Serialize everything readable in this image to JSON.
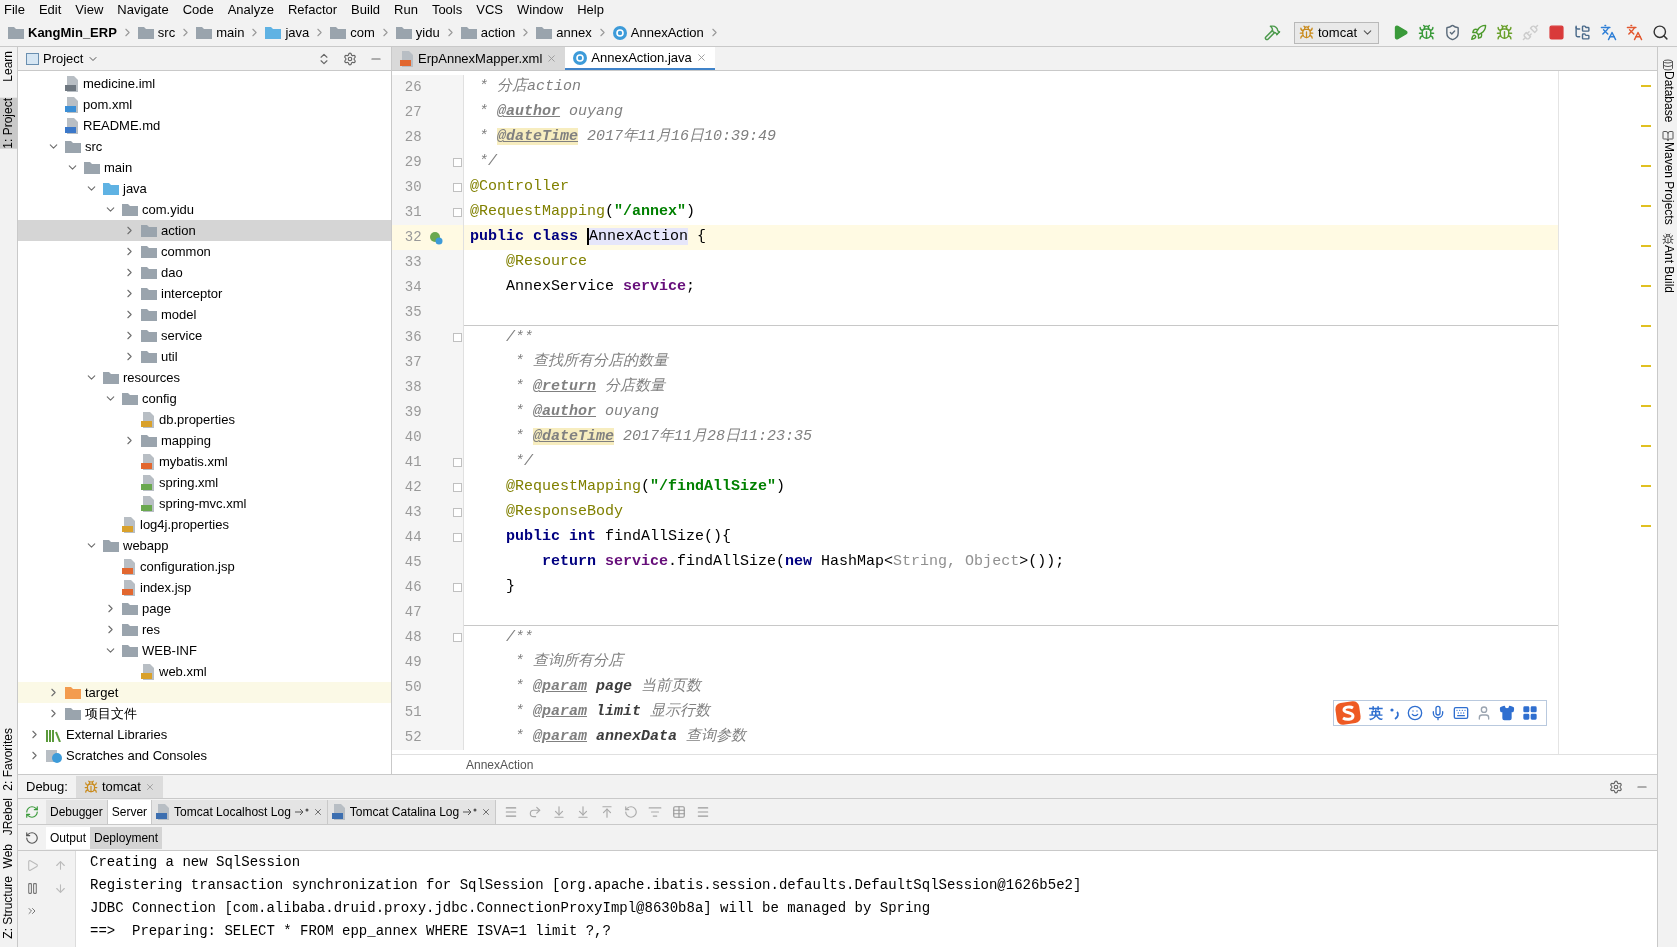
{
  "menu": [
    "File",
    "Edit",
    "View",
    "Navigate",
    "Code",
    "Analyze",
    "Refactor",
    "Build",
    "Run",
    "Tools",
    "VCS",
    "Window",
    "Help"
  ],
  "breadcrumb": [
    {
      "label": "KangMin_ERP",
      "kind": "project"
    },
    {
      "label": "src",
      "kind": "folder"
    },
    {
      "label": "main",
      "kind": "folder"
    },
    {
      "label": "java",
      "kind": "source-folder"
    },
    {
      "label": "com",
      "kind": "package"
    },
    {
      "label": "yidu",
      "kind": "package"
    },
    {
      "label": "action",
      "kind": "package"
    },
    {
      "label": "annex",
      "kind": "package"
    },
    {
      "label": "AnnexAction",
      "kind": "class"
    }
  ],
  "toolbar": [
    {
      "kind": "build",
      "disabled": false
    },
    {
      "kind": "run-config",
      "label": "tomcat",
      "disabled": false
    },
    {
      "kind": "run",
      "disabled": false
    },
    {
      "kind": "debug",
      "disabled": false
    },
    {
      "kind": "coverage",
      "disabled": false
    },
    {
      "kind": "jrebel-run",
      "disabled": false
    },
    {
      "kind": "jrebel-debug",
      "disabled": false
    },
    {
      "kind": "attach",
      "disabled": true
    },
    {
      "kind": "stop",
      "disabled": false
    },
    {
      "kind": "structure",
      "disabled": false
    },
    {
      "kind": "translate",
      "disabled": false
    },
    {
      "kind": "translate-alt",
      "disabled": false
    },
    {
      "kind": "search",
      "disabled": false
    }
  ],
  "left_stripe": {
    "top": [
      {
        "label": "Learn",
        "selected": false
      },
      {
        "label": "1: Project",
        "selected": true
      }
    ],
    "bottom": [
      {
        "label": "2: Favorites",
        "selected": false
      },
      {
        "label": "JRebel",
        "selected": false
      },
      {
        "label": "Web",
        "selected": false
      },
      {
        "label": "Z: Structure",
        "selected": false
      }
    ]
  },
  "right_stripe": [
    {
      "label": "Database",
      "kind": "database"
    },
    {
      "label": "Maven Projects",
      "kind": "maven"
    },
    {
      "label": "Ant Build",
      "kind": "ant"
    }
  ],
  "project_panel": {
    "title": "Project",
    "project_items": [
      {
        "label": "medicine.iml",
        "kind": "module-file",
        "selected": false
      },
      {
        "label": "pom.xml",
        "kind": "maven-file",
        "selected": false
      },
      {
        "label": "README.md",
        "kind": "markdown-file",
        "selected": false
      },
      {
        "label": "src",
        "kind": "folder",
        "expanded": true,
        "selected": false,
        "children": [
          {
            "label": "main",
            "kind": "folder",
            "expanded": true,
            "selected": false,
            "children": [
              {
                "label": "java",
                "kind": "source-folder",
                "expanded": true,
                "selected": false,
                "children": [
                  {
                    "label": "com.yidu",
                    "kind": "package",
                    "expanded": true,
                    "selected": false,
                    "children": [
                      {
                        "label": "action",
                        "kind": "package",
                        "expanded": false,
                        "selected": true
                      },
                      {
                        "label": "common",
                        "kind": "package",
                        "expanded": false,
                        "selected": false
                      },
                      {
                        "label": "dao",
                        "kind": "package",
                        "expanded": false,
                        "selected": false
                      },
                      {
                        "label": "interceptor",
                        "kind": "package",
                        "expanded": false,
                        "selected": false
                      },
                      {
                        "label": "model",
                        "kind": "package",
                        "expanded": false,
                        "selected": false
                      },
                      {
                        "label": "service",
                        "kind": "package",
                        "expanded": false,
                        "selected": false
                      },
                      {
                        "label": "util",
                        "kind": "package",
                        "expanded": false,
                        "selected": false
                      }
                    ]
                  }
                ]
              },
              {
                "label": "resources",
                "kind": "resource-folder",
                "expanded": true,
                "selected": false,
                "children": [
                  {
                    "label": "config",
                    "kind": "package",
                    "expanded": true,
                    "selected": false,
                    "children": [
                      {
                        "label": "db.properties",
                        "kind": "properties-file",
                        "selected": false
                      },
                      {
                        "label": "mapping",
                        "kind": "package",
                        "expanded": false,
                        "selected": false
                      },
                      {
                        "label": "mybatis.xml",
                        "kind": "xml-file",
                        "selected": false
                      },
                      {
                        "label": "spring.xml",
                        "kind": "spring-file",
                        "selected": false
                      },
                      {
                        "label": "spring-mvc.xml",
                        "kind": "spring-file",
                        "selected": false
                      }
                    ]
                  },
                  {
                    "label": "log4j.properties",
                    "kind": "properties-file",
                    "selected": false
                  }
                ]
              },
              {
                "label": "webapp",
                "kind": "web-folder",
                "expanded": true,
                "selected": false,
                "children": [
                  {
                    "label": "configuration.jsp",
                    "kind": "jsp-file",
                    "selected": false
                  },
                  {
                    "label": "index.jsp",
                    "kind": "jsp-file",
                    "selected": false
                  },
                  {
                    "label": "page",
                    "kind": "folder",
                    "expanded": false,
                    "selected": false
                  },
                  {
                    "label": "res",
                    "kind": "folder",
                    "expanded": false,
                    "selected": false
                  },
                  {
                    "label": "WEB-INF",
                    "kind": "folder",
                    "expanded": true,
                    "selected": false,
                    "children": [
                      {
                        "label": "web.xml",
                        "kind": "web-xml-file",
                        "selected": false
                      }
                    ]
                  }
                ]
              }
            ]
          }
        ]
      },
      {
        "label": "target",
        "kind": "excluded-folder",
        "expanded": false,
        "selected": false
      },
      {
        "label": "项目文件",
        "kind": "folder",
        "expanded": false,
        "selected": false
      }
    ],
    "root_items": [
      {
        "label": "External Libraries",
        "kind": "library",
        "expanded": false,
        "selected": false
      },
      {
        "label": "Scratches and Consoles",
        "kind": "scratches",
        "expanded": false,
        "selected": false
      }
    ]
  },
  "editor": {
    "tabs": [
      {
        "label": "ErpAnnexMapper.xml",
        "kind": "xml",
        "selected": false
      },
      {
        "label": "AnnexAction.java",
        "kind": "class",
        "selected": true
      }
    ],
    "lines": [
      {
        "number": "26",
        "tokens": [
          {
            "text": " * 分店action",
            "kind": "doc"
          }
        ]
      },
      {
        "number": "27",
        "tokens": [
          {
            "text": " * ",
            "kind": "doc"
          },
          {
            "text": "@author",
            "kind": "tag"
          },
          {
            "text": " ouyang",
            "kind": "doc"
          }
        ]
      },
      {
        "number": "28",
        "tokens": [
          {
            "text": " * ",
            "kind": "doc"
          },
          {
            "text": "@dateTime",
            "kind": "tag-hl"
          },
          {
            "text": " 2017年11月16日10:39:49",
            "kind": "doc"
          }
        ]
      },
      {
        "number": "29",
        "fold": true,
        "tokens": [
          {
            "text": " */",
            "kind": "doc"
          }
        ]
      },
      {
        "number": "30",
        "fold": true,
        "tokens": [
          {
            "text": "@Controller",
            "kind": "annotation"
          }
        ]
      },
      {
        "number": "31",
        "fold": true,
        "tokens": [
          {
            "text": "@RequestMapping",
            "kind": "annotation"
          },
          {
            "text": "(",
            "kind": "plain"
          },
          {
            "text": "\"/annex\"",
            "kind": "string"
          },
          {
            "text": ")",
            "kind": "plain"
          }
        ]
      },
      {
        "number": "32",
        "current": true,
        "bean": true,
        "tokens": [
          {
            "text": "public class ",
            "kind": "keyword"
          },
          {
            "text": "AnnexAction",
            "kind": "caret-ident"
          },
          {
            "text": " {",
            "kind": "plain"
          }
        ]
      },
      {
        "number": "33",
        "tokens": [
          {
            "text": "    @Resource",
            "kind": "annotation"
          }
        ]
      },
      {
        "number": "34",
        "tokens": [
          {
            "text": "    AnnexService ",
            "kind": "plain"
          },
          {
            "text": "service",
            "kind": "field"
          },
          {
            "text": ";",
            "kind": "plain"
          }
        ]
      },
      {
        "number": "35"
      },
      {
        "number": "36",
        "fold": true,
        "separator": true,
        "tokens": [
          {
            "text": "    /**",
            "kind": "doc"
          }
        ]
      },
      {
        "number": "37",
        "tokens": [
          {
            "text": "     * 查找所有分店的数量",
            "kind": "doc"
          }
        ]
      },
      {
        "number": "38",
        "tokens": [
          {
            "text": "     * ",
            "kind": "doc"
          },
          {
            "text": "@return",
            "kind": "tag"
          },
          {
            "text": " 分店数量",
            "kind": "doc"
          }
        ]
      },
      {
        "number": "39",
        "tokens": [
          {
            "text": "     * ",
            "kind": "doc"
          },
          {
            "text": "@author",
            "kind": "tag"
          },
          {
            "text": " ouyang",
            "kind": "doc"
          }
        ]
      },
      {
        "number": "40",
        "tokens": [
          {
            "text": "     * ",
            "kind": "doc"
          },
          {
            "text": "@dateTime",
            "kind": "tag-hl"
          },
          {
            "text": " 2017年11月28日11:23:35",
            "kind": "doc"
          }
        ]
      },
      {
        "number": "41",
        "fold": true,
        "tokens": [
          {
            "text": "     */",
            "kind": "doc"
          }
        ]
      },
      {
        "number": "42",
        "fold": true,
        "tokens": [
          {
            "text": "    @RequestMapping",
            "kind": "annotation"
          },
          {
            "text": "(",
            "kind": "plain"
          },
          {
            "text": "\"/findAllSize\"",
            "kind": "string"
          },
          {
            "text": ")",
            "kind": "plain"
          }
        ]
      },
      {
        "number": "43",
        "fold": true,
        "tokens": [
          {
            "text": "    @ResponseBody",
            "kind": "annotation"
          }
        ]
      },
      {
        "number": "44",
        "fold": true,
        "tokens": [
          {
            "text": "    public int ",
            "kind": "keyword"
          },
          {
            "text": "findAllSize(){",
            "kind": "plain"
          }
        ]
      },
      {
        "number": "45",
        "tokens": [
          {
            "text": "        return ",
            "kind": "keyword"
          },
          {
            "text": "service",
            "kind": "field"
          },
          {
            "text": ".findAllSize(",
            "kind": "plain"
          },
          {
            "text": "new ",
            "kind": "keyword"
          },
          {
            "text": "HashMap<",
            "kind": "plain"
          },
          {
            "text": "String, Object",
            "kind": "generic"
          },
          {
            "text": ">());",
            "kind": "plain"
          }
        ]
      },
      {
        "number": "46",
        "fold": true,
        "tokens": [
          {
            "text": "    }",
            "kind": "plain"
          }
        ]
      },
      {
        "number": "47"
      },
      {
        "number": "48",
        "fold": true,
        "separator": true,
        "tokens": [
          {
            "text": "    /**",
            "kind": "doc"
          }
        ]
      },
      {
        "number": "49",
        "tokens": [
          {
            "text": "     * 查询所有分店",
            "kind": "doc"
          }
        ]
      },
      {
        "number": "50",
        "tokens": [
          {
            "text": "     * ",
            "kind": "doc"
          },
          {
            "text": "@param",
            "kind": "tag"
          },
          {
            "text": " page",
            "kind": "param"
          },
          {
            "text": " 当前页数",
            "kind": "doc"
          }
        ]
      },
      {
        "number": "51",
        "tokens": [
          {
            "text": "     * ",
            "kind": "doc"
          },
          {
            "text": "@param",
            "kind": "tag"
          },
          {
            "text": " limit",
            "kind": "param"
          },
          {
            "text": " 显示行数",
            "kind": "doc"
          }
        ]
      },
      {
        "number": "52",
        "tokens": [
          {
            "text": "     * ",
            "kind": "doc"
          },
          {
            "text": "@param",
            "kind": "tag"
          },
          {
            "text": " annexData",
            "kind": "param"
          },
          {
            "text": " 查询参数",
            "kind": "doc"
          }
        ]
      }
    ],
    "footer": "AnnexAction"
  },
  "ime_toolbar": {
    "mode": "英"
  },
  "debug": {
    "title": "Debug:",
    "session_tab": "tomcat",
    "tabs": [
      {
        "label": "Debugger",
        "selected": false,
        "pinned": false
      },
      {
        "label": "Server",
        "selected": true,
        "pinned": false
      },
      {
        "label": "Tomcat Localhost Log",
        "selected": false,
        "pinned": true
      },
      {
        "label": "Tomcat Catalina Log",
        "selected": false,
        "pinned": true
      }
    ],
    "sub_tabs": [
      {
        "label": "Output",
        "selected": true
      },
      {
        "label": "Deployment",
        "selected": false
      }
    ],
    "console": [
      "Creating a new SqlSession",
      "Registering transaction synchronization for SqlSession [org.apache.ibatis.session.defaults.DefaultSqlSession@1626b5e2]",
      "JDBC Connection [com.alibaba.druid.proxy.jdbc.ConnectionProxyImpl@8630b8a] will be managed by Spring",
      "==>  Preparing: SELECT * FROM epp_annex WHERE ISVA=1 limit ?,?"
    ]
  }
}
